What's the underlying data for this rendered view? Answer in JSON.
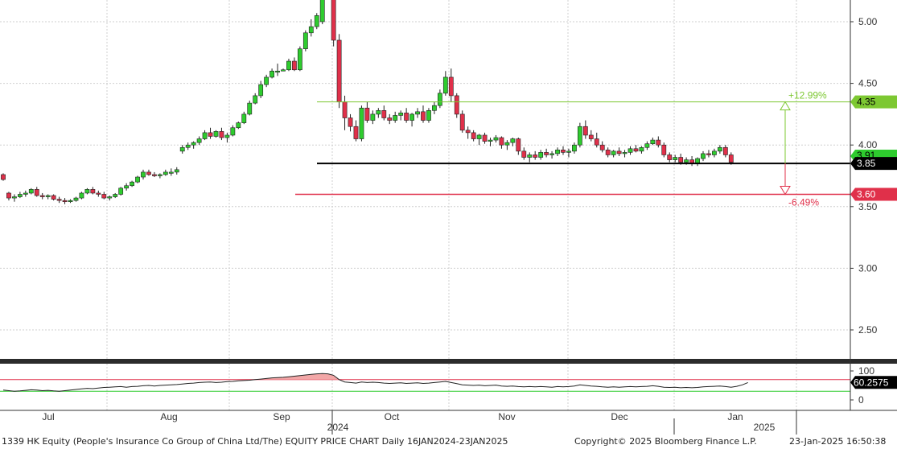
{
  "chart_data": {
    "type": "candlestick",
    "ylim": [
      2.27,
      5.17
    ],
    "y_ticks": [
      "5.00",
      "4.50",
      "4.00",
      "3.50",
      "3.00",
      "2.50"
    ],
    "x_ticks": [
      "Jul",
      "Aug",
      "Sep",
      "Oct",
      "Nov",
      "Dec",
      "Jan"
    ],
    "year_labels": [
      "2024",
      "2025"
    ],
    "colors": {
      "up": "#2ecc2e",
      "down": "#e0304a",
      "level_upper": "#7dc832",
      "level_mid": "#000000",
      "level_lower": "#e0304a"
    },
    "candles": [
      [
        3.76,
        3.77,
        3.71,
        3.72
      ],
      [
        3.61,
        3.62,
        3.55,
        3.57
      ],
      [
        3.57,
        3.6,
        3.54,
        3.58
      ],
      [
        3.58,
        3.62,
        3.57,
        3.6
      ],
      [
        3.6,
        3.63,
        3.58,
        3.61
      ],
      [
        3.61,
        3.65,
        3.6,
        3.64
      ],
      [
        3.64,
        3.66,
        3.58,
        3.59
      ],
      [
        3.59,
        3.61,
        3.56,
        3.58
      ],
      [
        3.58,
        3.6,
        3.56,
        3.59
      ],
      [
        3.59,
        3.6,
        3.55,
        3.56
      ],
      [
        3.56,
        3.58,
        3.53,
        3.55
      ],
      [
        3.55,
        3.57,
        3.52,
        3.54
      ],
      [
        3.54,
        3.56,
        3.53,
        3.55
      ],
      [
        3.55,
        3.58,
        3.54,
        3.57
      ],
      [
        3.57,
        3.62,
        3.56,
        3.61
      ],
      [
        3.61,
        3.65,
        3.6,
        3.64
      ],
      [
        3.64,
        3.66,
        3.6,
        3.61
      ],
      [
        3.61,
        3.63,
        3.58,
        3.6
      ],
      [
        3.6,
        3.62,
        3.56,
        3.57
      ],
      [
        3.57,
        3.59,
        3.55,
        3.58
      ],
      [
        3.58,
        3.61,
        3.57,
        3.6
      ],
      [
        3.6,
        3.66,
        3.59,
        3.65
      ],
      [
        3.65,
        3.69,
        3.63,
        3.67
      ],
      [
        3.67,
        3.71,
        3.66,
        3.7
      ],
      [
        3.7,
        3.75,
        3.69,
        3.74
      ],
      [
        3.74,
        3.8,
        3.72,
        3.78
      ],
      [
        3.78,
        3.8,
        3.75,
        3.76
      ],
      [
        3.76,
        3.78,
        3.74,
        3.75
      ],
      [
        3.75,
        3.77,
        3.73,
        3.76
      ],
      [
        3.76,
        3.8,
        3.75,
        3.78
      ],
      [
        3.78,
        3.81,
        3.75,
        3.78
      ],
      [
        3.78,
        3.82,
        3.76,
        3.8
      ],
      [
        3.95,
        4.0,
        3.93,
        3.98
      ],
      [
        3.98,
        4.02,
        3.96,
        4.0
      ],
      [
        4.0,
        4.03,
        3.97,
        4.02
      ],
      [
        4.02,
        4.07,
        4.0,
        4.05
      ],
      [
        4.05,
        4.12,
        4.04,
        4.1
      ],
      [
        4.1,
        4.14,
        4.05,
        4.07
      ],
      [
        4.07,
        4.12,
        4.06,
        4.11
      ],
      [
        4.11,
        4.14,
        4.04,
        4.06
      ],
      [
        4.06,
        4.1,
        4.02,
        4.08
      ],
      [
        4.08,
        4.16,
        4.07,
        4.14
      ],
      [
        4.14,
        4.19,
        4.13,
        4.18
      ],
      [
        4.18,
        4.27,
        4.17,
        4.25
      ],
      [
        4.25,
        4.36,
        4.24,
        4.34
      ],
      [
        4.34,
        4.42,
        4.33,
        4.4
      ],
      [
        4.4,
        4.52,
        4.38,
        4.49
      ],
      [
        4.49,
        4.57,
        4.47,
        4.55
      ],
      [
        4.55,
        4.62,
        4.54,
        4.6
      ],
      [
        4.6,
        4.66,
        4.56,
        4.6
      ],
      [
        4.6,
        4.62,
        4.6,
        4.61
      ],
      [
        4.61,
        4.7,
        4.6,
        4.68
      ],
      [
        4.68,
        4.71,
        4.6,
        4.61
      ],
      [
        4.61,
        4.8,
        4.6,
        4.78
      ],
      [
        4.78,
        4.93,
        4.76,
        4.91
      ],
      [
        4.91,
        5.02,
        4.88,
        4.96
      ],
      [
        4.96,
        5.07,
        4.94,
        5.05
      ],
      [
        5.0,
        5.33,
        4.98,
        5.3
      ],
      [
        5.3,
        5.5,
        5.28,
        5.35
      ],
      [
        5.35,
        5.37,
        4.8,
        4.85
      ],
      [
        4.85,
        4.9,
        4.3,
        4.35
      ],
      [
        4.35,
        4.4,
        4.12,
        4.22
      ],
      [
        4.22,
        4.25,
        4.11,
        4.15
      ],
      [
        4.15,
        4.2,
        4.03,
        4.05
      ],
      [
        4.05,
        4.32,
        4.03,
        4.3
      ],
      [
        4.3,
        4.35,
        4.18,
        4.2
      ],
      [
        4.2,
        4.28,
        4.17,
        4.25
      ],
      [
        4.25,
        4.3,
        4.22,
        4.28
      ],
      [
        4.28,
        4.32,
        4.2,
        4.22
      ],
      [
        4.22,
        4.25,
        4.17,
        4.2
      ],
      [
        4.2,
        4.27,
        4.18,
        4.24
      ],
      [
        4.24,
        4.28,
        4.2,
        4.26
      ],
      [
        4.26,
        4.3,
        4.18,
        4.2
      ],
      [
        4.2,
        4.26,
        4.15,
        4.25
      ],
      [
        4.25,
        4.3,
        4.22,
        4.27
      ],
      [
        4.27,
        4.32,
        4.18,
        4.2
      ],
      [
        4.2,
        4.3,
        4.18,
        4.28
      ],
      [
        4.28,
        4.35,
        4.25,
        4.32
      ],
      [
        4.32,
        4.45,
        4.3,
        4.42
      ],
      [
        4.42,
        4.6,
        4.4,
        4.55
      ],
      [
        4.55,
        4.62,
        4.35,
        4.4
      ],
      [
        4.4,
        4.42,
        4.22,
        4.25
      ],
      [
        4.25,
        4.28,
        4.1,
        4.12
      ],
      [
        4.12,
        4.15,
        4.05,
        4.1
      ],
      [
        4.1,
        4.12,
        4.03,
        4.05
      ],
      [
        4.05,
        4.09,
        4.0,
        4.08
      ],
      [
        4.08,
        4.1,
        4.01,
        4.03
      ],
      [
        4.03,
        4.06,
        3.99,
        4.04
      ],
      [
        4.04,
        4.08,
        4.02,
        4.06
      ],
      [
        4.06,
        4.07,
        3.97,
        4.0
      ],
      [
        4.0,
        4.04,
        3.96,
        4.02
      ],
      [
        4.02,
        4.06,
        3.99,
        4.05
      ],
      [
        4.05,
        4.06,
        3.92,
        3.95
      ],
      [
        3.95,
        3.98,
        3.88,
        3.9
      ],
      [
        3.9,
        3.94,
        3.86,
        3.92
      ],
      [
        3.92,
        3.95,
        3.88,
        3.9
      ],
      [
        3.9,
        3.96,
        3.88,
        3.94
      ],
      [
        3.94,
        3.97,
        3.9,
        3.92
      ],
      [
        3.92,
        3.95,
        3.89,
        3.93
      ],
      [
        3.93,
        3.98,
        3.91,
        3.96
      ],
      [
        3.96,
        3.99,
        3.92,
        3.94
      ],
      [
        3.94,
        3.97,
        3.9,
        3.95
      ],
      [
        3.95,
        4.02,
        3.93,
        4.0
      ],
      [
        4.0,
        4.18,
        3.98,
        4.15
      ],
      [
        4.15,
        4.2,
        4.05,
        4.08
      ],
      [
        4.08,
        4.12,
        4.03,
        4.05
      ],
      [
        4.05,
        4.1,
        3.98,
        4.0
      ],
      [
        4.0,
        4.03,
        3.94,
        3.96
      ],
      [
        3.96,
        3.98,
        3.9,
        3.92
      ],
      [
        3.92,
        3.96,
        3.9,
        3.95
      ],
      [
        3.95,
        3.98,
        3.91,
        3.93
      ],
      [
        3.93,
        3.96,
        3.9,
        3.94
      ],
      [
        3.94,
        3.99,
        3.92,
        3.97
      ],
      [
        3.97,
        4.0,
        3.94,
        3.95
      ],
      [
        3.95,
        3.99,
        3.93,
        3.98
      ],
      [
        3.98,
        4.03,
        3.96,
        4.01
      ],
      [
        4.01,
        4.06,
        4.0,
        4.04
      ],
      [
        4.04,
        4.07,
        3.98,
        4.0
      ],
      [
        4.0,
        4.02,
        3.9,
        3.92
      ],
      [
        3.92,
        3.94,
        3.86,
        3.88
      ],
      [
        3.88,
        3.92,
        3.86,
        3.9
      ],
      [
        3.9,
        3.93,
        3.84,
        3.86
      ],
      [
        3.86,
        3.9,
        3.84,
        3.88
      ],
      [
        3.88,
        3.91,
        3.83,
        3.85
      ],
      [
        3.85,
        3.9,
        3.83,
        3.89
      ],
      [
        3.89,
        3.95,
        3.87,
        3.93
      ],
      [
        3.93,
        3.96,
        3.9,
        3.92
      ],
      [
        3.92,
        3.97,
        3.9,
        3.95
      ],
      [
        3.95,
        4.0,
        3.93,
        3.98
      ],
      [
        3.98,
        4.0,
        3.9,
        3.92
      ],
      [
        3.92,
        3.94,
        3.84,
        3.86
      ]
    ],
    "levels": [
      {
        "value": 4.35,
        "label": "4.35",
        "pct": "+12.99%"
      },
      {
        "value": 3.85,
        "label": "3.85"
      },
      {
        "value": 3.6,
        "label": "3.60",
        "pct": "-6.49%"
      }
    ],
    "hidden_price_label": "3.91",
    "rsi": {
      "label": "60.2575",
      "y_ticks": [
        "100",
        "0"
      ],
      "upper": 70,
      "lower": 30,
      "values": [
        34,
        32,
        30,
        31,
        33,
        35,
        34,
        32,
        33,
        31,
        30,
        32,
        34,
        36,
        38,
        40,
        39,
        41,
        43,
        44,
        45,
        46,
        44,
        46,
        47,
        49,
        50,
        48,
        50,
        51,
        52,
        53,
        55,
        57,
        58,
        60,
        61,
        62,
        60,
        61,
        63,
        64,
        66,
        67,
        68,
        70,
        72,
        74,
        76,
        77,
        78,
        80,
        82,
        84,
        86,
        88,
        90,
        91,
        90,
        85,
        70,
        62,
        60,
        58,
        62,
        60,
        61,
        60,
        58,
        57,
        58,
        59,
        57,
        58,
        59,
        57,
        58,
        60,
        62,
        64,
        60,
        56,
        52,
        51,
        50,
        51,
        49,
        50,
        51,
        48,
        47,
        48,
        46,
        45,
        46,
        45,
        46,
        45,
        44,
        46,
        45,
        46,
        48,
        52,
        50,
        48,
        47,
        45,
        44,
        45,
        44,
        45,
        46,
        45,
        46,
        47,
        49,
        47,
        44,
        43,
        44,
        42,
        43,
        42,
        43,
        45,
        46,
        47,
        48,
        46,
        44,
        47,
        52,
        60
      ]
    }
  },
  "footer": {
    "title": "1339 HK Equity (People's Insurance Co Group of China Ltd/The) EQUITY PRICE CHART  Daily 16JAN2024-23JAN2025",
    "copyright": "Copyright© 2025 Bloomberg Finance L.P.",
    "timestamp": "23-Jan-2025 16:50:38"
  }
}
